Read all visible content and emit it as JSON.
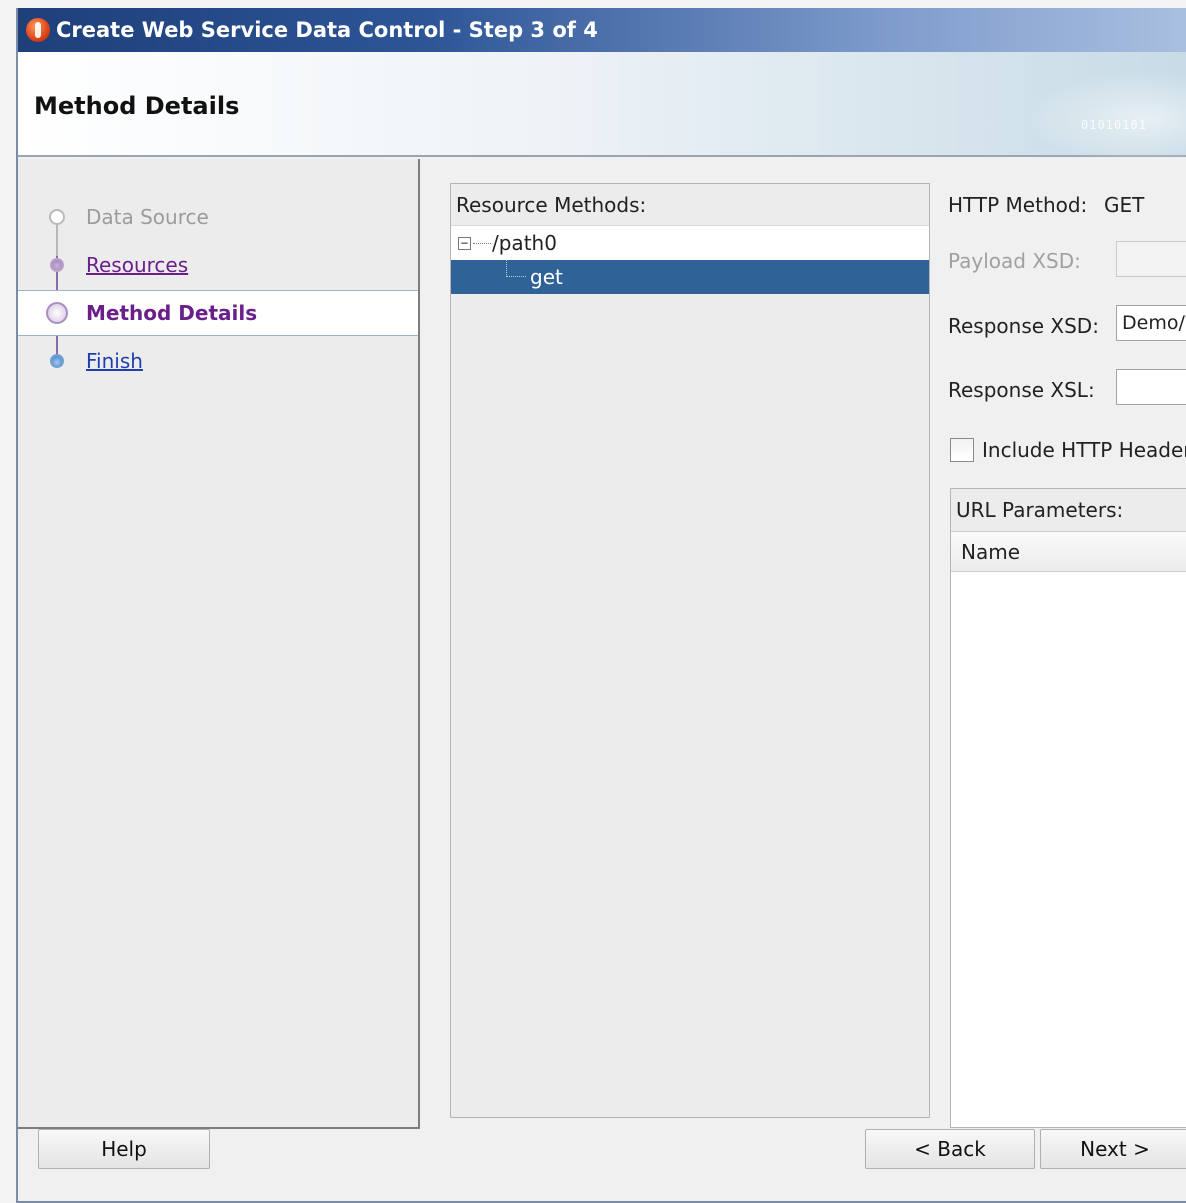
{
  "window": {
    "title": "Create Web Service Data Control - Step 3 of 4"
  },
  "header": {
    "title": "Method Details",
    "decoration_text": "01010101"
  },
  "wizard_steps": [
    {
      "label": "Data Source",
      "state": "disabled"
    },
    {
      "label": "Resources",
      "state": "visited"
    },
    {
      "label": "Method Details",
      "state": "current"
    },
    {
      "label": "Finish",
      "state": "link"
    }
  ],
  "resource_methods": {
    "title": "Resource Methods:",
    "tree": [
      {
        "label": "/path0",
        "expanded": true,
        "expander": "−"
      },
      {
        "label": "get",
        "selected": true
      }
    ]
  },
  "method_details": {
    "http_method_label": "HTTP Method:",
    "http_method_value": "GET",
    "payload_xsd_label": "Payload XSD:",
    "payload_xsd_value": "",
    "response_xsd_label": "Response XSD:",
    "response_xsd_value": "Demo/WebServiceDataControl",
    "response_xsl_label": "Response XSL:",
    "response_xsl_value": "",
    "include_http_header_label": "Include HTTP Header",
    "include_http_header_checked": false
  },
  "url_parameters": {
    "title": "URL Parameters:",
    "columns": [
      "Name"
    ],
    "rows": []
  },
  "buttons": {
    "help": "Help",
    "back": "< Back",
    "next": "Next >"
  }
}
